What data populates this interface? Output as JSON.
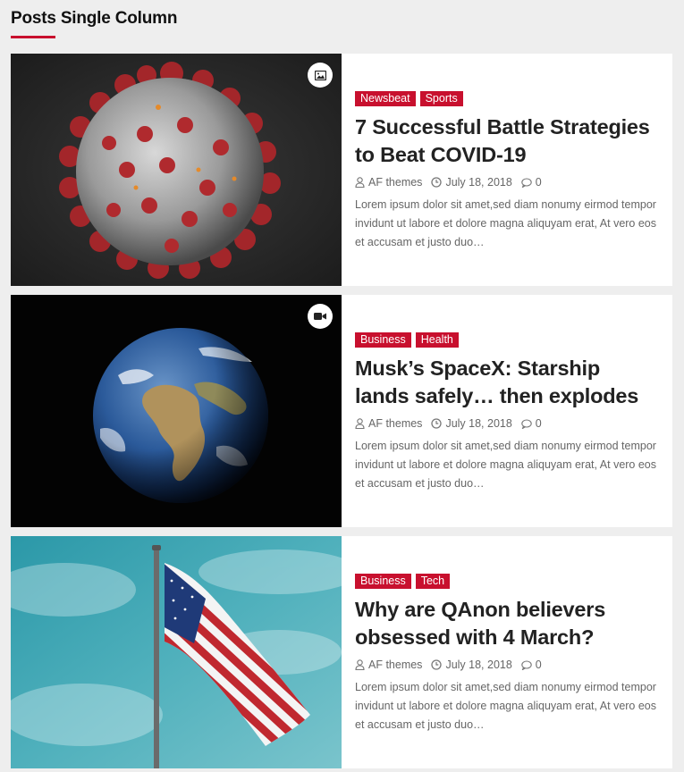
{
  "section": {
    "title": "Posts Single Column",
    "accent": "#c8102e"
  },
  "posts": [
    {
      "format_icon": "image-icon",
      "categories": [
        "Newsbeat",
        "Sports"
      ],
      "title": "7 Successful Battle Strategies to Beat COVID-19",
      "author": "AF themes",
      "date": "July 18, 2018",
      "comments": "0",
      "excerpt": "Lorem ipsum dolor sit amet,sed diam nonumy eirmod tempor invidunt ut labore et dolore magna aliquyam erat, At vero eos et accusam et justo duo…"
    },
    {
      "format_icon": "video-icon",
      "categories": [
        "Business",
        "Health"
      ],
      "title": "Musk’s SpaceX: Starship lands safely… then explodes",
      "author": "AF themes",
      "date": "July 18, 2018",
      "comments": "0",
      "excerpt": "Lorem ipsum dolor sit amet,sed diam nonumy eirmod tempor invidunt ut labore et dolore magna aliquyam erat, At vero eos et accusam et justo duo…"
    },
    {
      "format_icon": "",
      "categories": [
        "Business",
        "Tech"
      ],
      "title": "Why are QAnon believers obsessed with 4 March?",
      "author": "AF themes",
      "date": "July 18, 2018",
      "comments": "0",
      "excerpt": "Lorem ipsum dolor sit amet,sed diam nonumy eirmod tempor invidunt ut labore et dolore magna aliquyam erat, At vero eos et accusam et justo duo…"
    }
  ]
}
